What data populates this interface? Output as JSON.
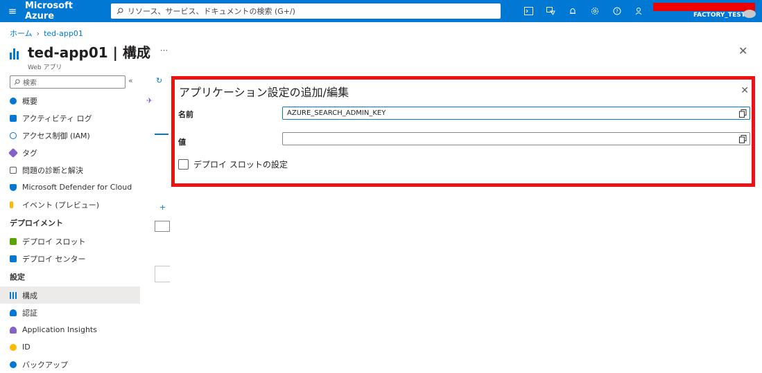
{
  "topbar": {
    "brand": "Microsoft Azure",
    "search_placeholder": "リソース、サービス、ドキュメントの検索 (G+/)",
    "tenant": "FACTORY_TEST"
  },
  "breadcrumb": {
    "home": "ホーム",
    "current": "ted-app01"
  },
  "header": {
    "title": "ted-app01 | 構成",
    "subtitle": "Web アプリ"
  },
  "sidebar": {
    "search_placeholder": "検索",
    "items": [
      {
        "label": "概要",
        "icon": "globe-icon",
        "color": "#0078d4"
      },
      {
        "label": "アクティビティ ログ",
        "icon": "log-icon",
        "color": "#0078d4"
      },
      {
        "label": "アクセス制御 (IAM)",
        "icon": "people-icon",
        "color": "#0078d4"
      },
      {
        "label": "タグ",
        "icon": "tag-icon",
        "color": "#8661c5"
      },
      {
        "label": "問題の診断と解決",
        "icon": "wrench-icon",
        "color": "#605e5c"
      },
      {
        "label": "Microsoft Defender for Cloud",
        "icon": "shield-icon",
        "color": "#0078d4"
      },
      {
        "label": "イベント (プレビュー)",
        "icon": "lightning-icon",
        "color": "#ffb900"
      }
    ],
    "section_deploy": "デプロイメント",
    "deploy_items": [
      {
        "label": "デプロイ スロット",
        "icon": "slots-icon",
        "color": "#57a300"
      },
      {
        "label": "デプロイ センター",
        "icon": "cube-icon",
        "color": "#0078d4"
      }
    ],
    "section_settings": "設定",
    "settings_items": [
      {
        "label": "構成",
        "icon": "config-icon",
        "color": "#0078d4"
      },
      {
        "label": "認証",
        "icon": "person-icon",
        "color": "#0078d4"
      },
      {
        "label": "Application Insights",
        "icon": "bulb-icon",
        "color": "#8661c5"
      },
      {
        "label": "ID",
        "icon": "key-icon",
        "color": "#ffb900"
      },
      {
        "label": "バックアップ",
        "icon": "backup-icon",
        "color": "#0078d4"
      }
    ]
  },
  "panel": {
    "title": "アプリケーション設定の追加/編集",
    "name_label": "名前",
    "name_value": "AZURE_SEARCH_ADMIN_KEY",
    "value_label": "値",
    "value_value": "",
    "slot_label": "デプロイ スロットの設定"
  },
  "colors": {
    "accent": "#0078d4",
    "highlight": "#ee1111"
  }
}
